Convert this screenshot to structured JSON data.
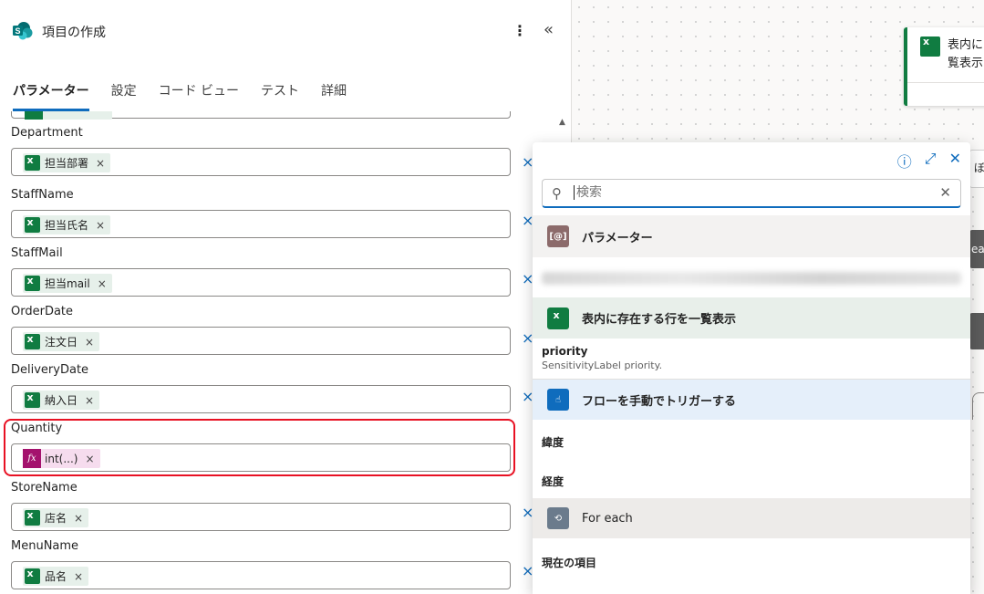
{
  "header": {
    "title": "項目の作成",
    "more": "⋮",
    "collapse": "«"
  },
  "tabs": [
    {
      "label": "パラメーター",
      "active": true
    },
    {
      "label": "設定"
    },
    {
      "label": "コード ビュー"
    },
    {
      "label": "テスト"
    },
    {
      "label": "詳細"
    }
  ],
  "fields": [
    {
      "label": "Department",
      "token": "担当部署",
      "kind": "excel"
    },
    {
      "label": "StaffName",
      "token": "担当氏名",
      "kind": "excel"
    },
    {
      "label": "StaffMail",
      "token": "担当mail",
      "kind": "excel"
    },
    {
      "label": "OrderDate",
      "token": "注文日",
      "kind": "excel"
    },
    {
      "label": "DeliveryDate",
      "token": "納入日",
      "kind": "excel"
    },
    {
      "label": "Quantity",
      "token": "int(...)",
      "kind": "fx"
    },
    {
      "label": "StoreName",
      "token": "店名",
      "kind": "excel"
    },
    {
      "label": "MenuName",
      "token": "品名",
      "kind": "excel"
    }
  ],
  "popup": {
    "search_placeholder": "検索",
    "sections": [
      {
        "label": "パラメーター",
        "icon": "[@]"
      },
      {
        "label": "表内に存在する行を一覧表示"
      },
      {
        "label": "フローを手動でトリガーする"
      },
      {
        "label": "For each"
      }
    ],
    "items": [
      {
        "name": "priority",
        "desc": "SensitivityLabel priority."
      },
      {
        "name": "緯度"
      },
      {
        "name": "経度"
      },
      {
        "name": "現在の項目"
      }
    ]
  },
  "canvas": {
    "card_line1": "表内に",
    "card_line2": "覧表示",
    "edge1": "ぼを",
    "edge2": "ea"
  },
  "icons": {
    "excel": "excel-icon",
    "fx": "function-icon",
    "remove": "×"
  },
  "colors": {
    "accent": "#0f6cbd",
    "excel": "#107c41",
    "fx": "#a4126d",
    "highlight": "#e81123"
  }
}
